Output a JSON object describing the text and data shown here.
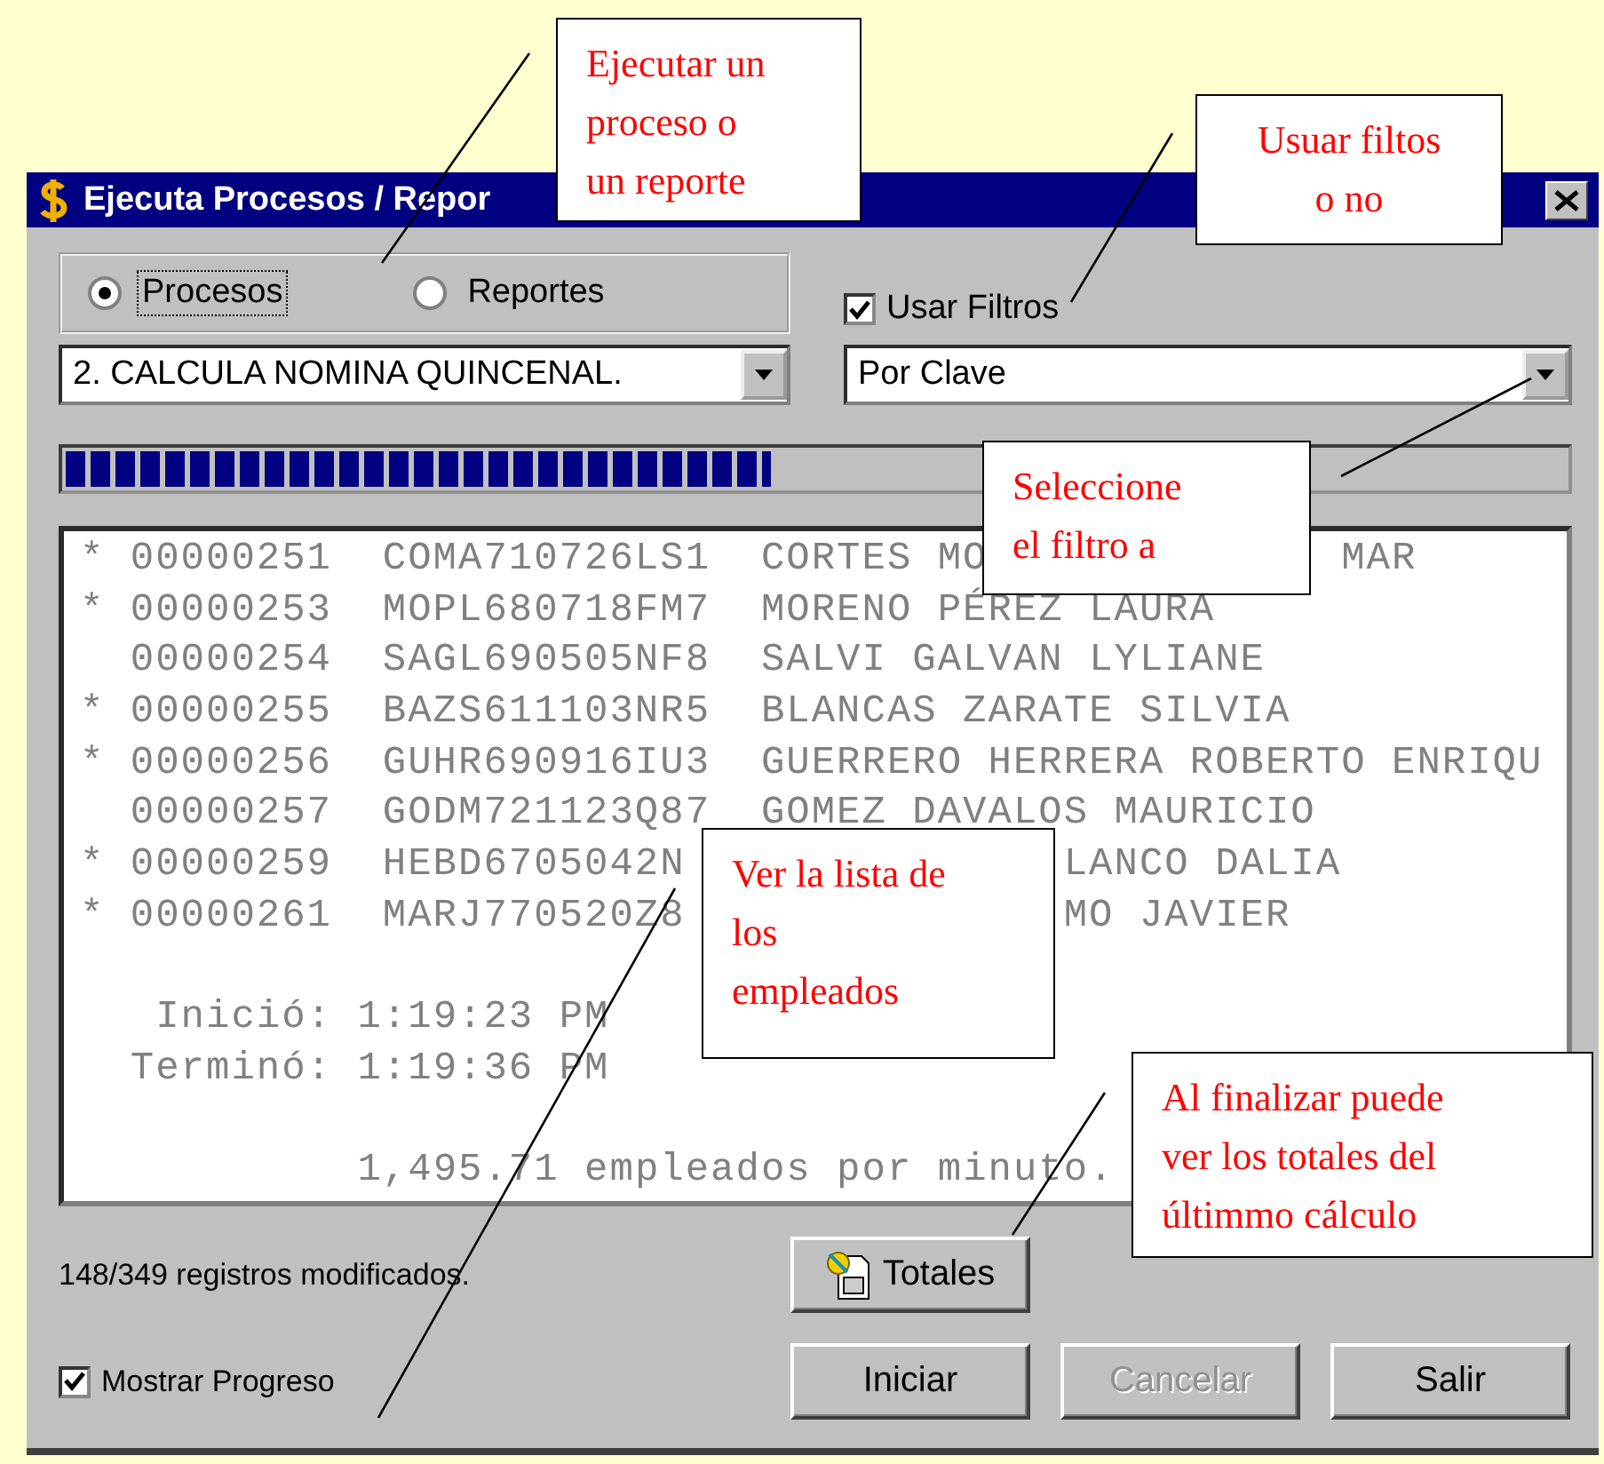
{
  "window": {
    "title": "Ejecuta Procesos / Repor"
  },
  "mode_options": [
    {
      "label": "Procesos",
      "selected": true
    },
    {
      "label": "Reportes",
      "selected": false
    }
  ],
  "use_filters": {
    "label": "Usar Filtros",
    "checked": true
  },
  "process_select": {
    "value": "2. CALCULA NOMINA QUINCENAL."
  },
  "filter_select": {
    "value": "Por Clave"
  },
  "progress": {
    "level": 0.47
  },
  "log": {
    "rows": [
      {
        "mark": "*",
        "number": "00000251",
        "rfc": "COMA710726LS1",
        "name": "CORTES MO",
        "tail": "MAR"
      },
      {
        "mark": "*",
        "number": "00000253",
        "rfc": "MOPL680718FM7",
        "name": "MORENO PÉREZ LAURA"
      },
      {
        "mark": "",
        "number": "00000254",
        "rfc": "SAGL690505NF8",
        "name": "SALVI GALVAN LYLIANE"
      },
      {
        "mark": "*",
        "number": "00000255",
        "rfc": "BAZS611103NR5",
        "name": "BLANCAS ZARATE SILVIA"
      },
      {
        "mark": "*",
        "number": "00000256",
        "rfc": "GUHR690916IU3",
        "name": "GUERRERO HERRERA ROBERTO ENRIQU"
      },
      {
        "mark": "",
        "number": "00000257",
        "rfc": "GODM721123Q87",
        "name": "GOMEZ DAVALOS MAURICIO"
      },
      {
        "mark": "*",
        "number": "00000259",
        "rfc": "HEBD6705042N",
        "name": "",
        "tail": "LANCO DALIA"
      },
      {
        "mark": "*",
        "number": "00000261",
        "rfc": "MARJ770520Z8",
        "name": "",
        "tail": "MO JAVIER"
      }
    ],
    "times": [
      {
        "label": "Inició:",
        "value": "1:19:23 PM"
      },
      {
        "label": "Terminó:",
        "value": "1:19:36 PM"
      }
    ],
    "rate": "1,495.71 empleados por minuto."
  },
  "status": "148/349 registros modificados.",
  "totals_button": "Totales",
  "show_progress": {
    "label": "Mostrar Progreso",
    "checked": true
  },
  "buttons": [
    {
      "label": "Iniciar",
      "disabled": false
    },
    {
      "label": "Cancelar",
      "disabled": true
    },
    {
      "label": "Salir",
      "disabled": false
    }
  ],
  "callouts": [
    {
      "lines": [
        "Ejecutar un",
        "proceso o",
        "un reporte"
      ]
    },
    {
      "lines": [
        "Usuar filtos",
        "o    no"
      ]
    },
    {
      "lines": [
        "Seleccione",
        "el filtro a"
      ]
    },
    {
      "lines": [
        "Ver la lista de",
        "los",
        "empleados"
      ]
    },
    {
      "lines": [
        "Al finalizar puede",
        "ver los totales del",
        "últimmo cálculo"
      ]
    }
  ]
}
